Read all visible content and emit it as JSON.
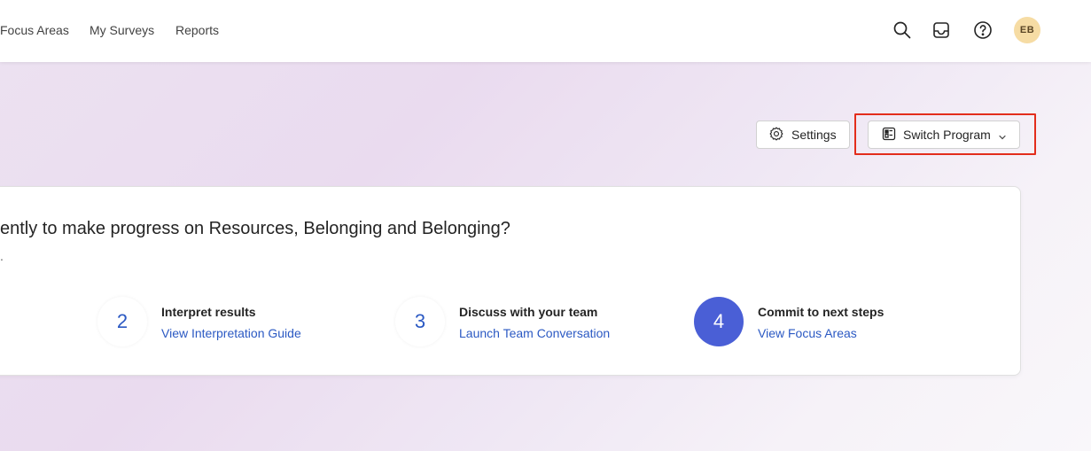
{
  "nav": {
    "links": [
      "Focus Areas",
      "My Surveys",
      "Reports"
    ]
  },
  "header": {
    "avatar_initials": "EB",
    "avatar_color": "#f6dca4"
  },
  "actions": {
    "settings_label": "Settings",
    "switch_label": "Switch Program",
    "highlight_color": "#e32d1c"
  },
  "card": {
    "title": "ently to make progress on Resources, Belonging and Belonging?",
    "subtitle": ".",
    "steps": [
      {
        "number": "2",
        "title": "Interpret results",
        "link": "View Interpretation Guide"
      },
      {
        "number": "3",
        "title": "Discuss with your team",
        "link": "Launch Team Conversation"
      },
      {
        "number": "4",
        "title": "Commit to next steps",
        "link": "View Focus Areas"
      }
    ]
  },
  "colors": {
    "accent": "#2b59c3",
    "active_step": "#4a5fd6"
  },
  "icons": [
    "search-icon",
    "inbox-icon",
    "help-icon",
    "gear-icon",
    "program-icon",
    "chevron-down-icon"
  ]
}
